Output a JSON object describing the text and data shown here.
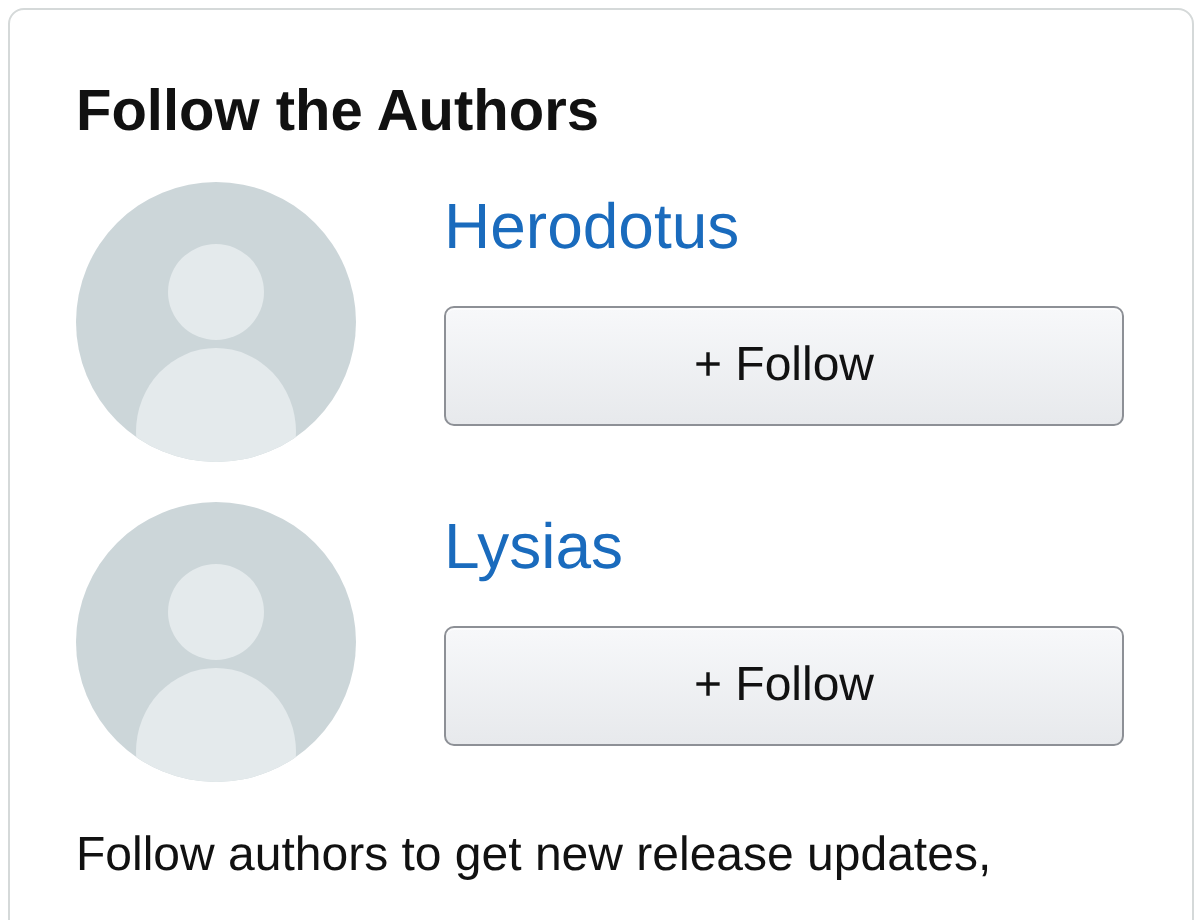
{
  "title": "Follow the Authors",
  "authors": [
    {
      "name": "Herodotus",
      "button": "+ Follow"
    },
    {
      "name": "Lysias",
      "button": "+ Follow"
    }
  ],
  "footer": "Follow authors to get new release updates,"
}
